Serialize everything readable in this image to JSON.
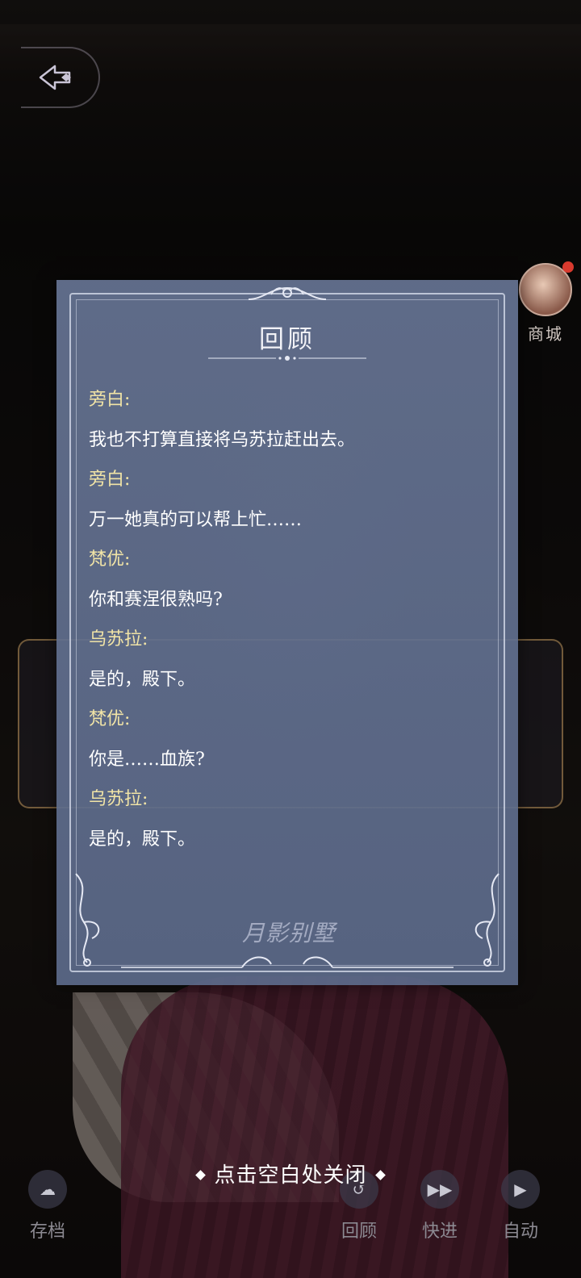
{
  "panel": {
    "title": "回顾",
    "entries": [
      {
        "speaker": "旁白:",
        "text": "我也不打算直接将乌苏拉赶出去。"
      },
      {
        "speaker": "旁白:",
        "text": "万一她真的可以帮上忙……"
      },
      {
        "speaker": "梵优:",
        "text": "你和赛涅很熟吗?"
      },
      {
        "speaker": "乌苏拉:",
        "text": "是的，殿下。"
      },
      {
        "speaker": "梵优:",
        "text": "你是……血族?"
      },
      {
        "speaker": "乌苏拉:",
        "text": "是的，殿下。"
      }
    ],
    "logo_text": "月影别墅"
  },
  "close_hint": "点击空白处关闭",
  "shop": {
    "label": "商城"
  },
  "bottom_bar": {
    "save": "存档",
    "review": "回顾",
    "fast_forward": "快进",
    "auto": "自动"
  },
  "colors": {
    "speaker": "#f1e4a6",
    "panel_bg": "#687696",
    "notification_dot": "#d83a2e"
  }
}
